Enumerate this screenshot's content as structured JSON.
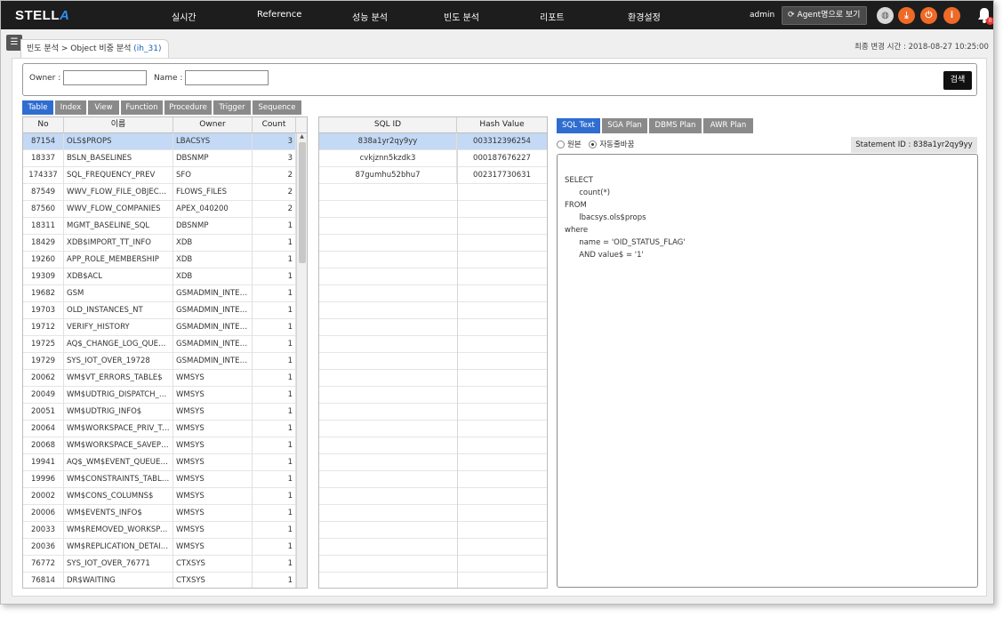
{
  "brand": {
    "name_prefix": "STELL",
    "name_suffix": "A"
  },
  "nav": [
    "실시간",
    "Reference",
    "성능 분석",
    "빈도 분석",
    "리포트",
    "환경설정"
  ],
  "header": {
    "user": "admin",
    "agent_button": "Agent명으로 보기",
    "notification_count": "0"
  },
  "breadcrumb": {
    "parent": "빈도 분석 > ",
    "current": "Object 비중 분석",
    "context": "(ih_31)"
  },
  "last_change": "최종 변경 시간 : 2018-08-27 10:25:00",
  "search": {
    "owner_label": "Owner :",
    "owner_value": "",
    "name_label": "Name :",
    "name_value": "",
    "button": "검색"
  },
  "object_tabs": [
    "Table",
    "Index",
    "View",
    "Function",
    "Procedure",
    "Trigger",
    "Sequence"
  ],
  "object_tab_selected": 0,
  "object_table": {
    "columns": [
      "No",
      "이름",
      "Owner",
      "Count"
    ],
    "rows": [
      [
        "87154",
        "OLS$PROPS",
        "LBACSYS",
        "3"
      ],
      [
        "18337",
        "BSLN_BASELINES",
        "DBSNMP",
        "3"
      ],
      [
        "174337",
        "SQL_FREQUENCY_PREV",
        "SFO",
        "2"
      ],
      [
        "87549",
        "WWV_FLOW_FILE_OBJECTS$",
        "FLOWS_FILES",
        "2"
      ],
      [
        "87560",
        "WWV_FLOW_COMPANIES",
        "APEX_040200",
        "2"
      ],
      [
        "18311",
        "MGMT_BASELINE_SQL",
        "DBSNMP",
        "1"
      ],
      [
        "18429",
        "XDB$IMPORT_TT_INFO",
        "XDB",
        "1"
      ],
      [
        "19260",
        "APP_ROLE_MEMBERSHIP",
        "XDB",
        "1"
      ],
      [
        "19309",
        "XDB$ACL",
        "XDB",
        "1"
      ],
      [
        "19682",
        "GSM",
        "GSMADMIN_INTERNAL",
        "1"
      ],
      [
        "19703",
        "OLD_INSTANCES_NT",
        "GSMADMIN_INTERNAL",
        "1"
      ],
      [
        "19712",
        "VERIFY_HISTORY",
        "GSMADMIN_INTERNAL",
        "1"
      ],
      [
        "19725",
        "AQ$_CHANGE_LOG_QUEUE_TABLE",
        "GSMADMIN_INTERNAL",
        "1"
      ],
      [
        "19729",
        "SYS_IOT_OVER_19728",
        "GSMADMIN_INTERNAL",
        "1"
      ],
      [
        "20062",
        "WM$VT_ERRORS_TABLE$",
        "WMSYS",
        "1"
      ],
      [
        "20049",
        "WM$UDTRIG_DISPATCH_PROCS$",
        "WMSYS",
        "1"
      ],
      [
        "20051",
        "WM$UDTRIG_INFO$",
        "WMSYS",
        "1"
      ],
      [
        "20064",
        "WM$WORKSPACE_PRIV_TABLE$",
        "WMSYS",
        "1"
      ],
      [
        "20068",
        "WM$WORKSPACE_SAVEPOINTS_TABLE$",
        "WMSYS",
        "1"
      ],
      [
        "19941",
        "AQ$_WM$EVENT_QUEUE_TABLE_S",
        "WMSYS",
        "1"
      ],
      [
        "19996",
        "WM$CONSTRAINTS_TABLE$",
        "WMSYS",
        "1"
      ],
      [
        "20002",
        "WM$CONS_COLUMNS$",
        "WMSYS",
        "1"
      ],
      [
        "20006",
        "WM$EVENTS_INFO$",
        "WMSYS",
        "1"
      ],
      [
        "20033",
        "WM$REMOVED_WORKSPACES_TABLE$",
        "WMSYS",
        "1"
      ],
      [
        "20036",
        "WM$REPLICATION_DETAILS_TABLE$",
        "WMSYS",
        "1"
      ],
      [
        "76772",
        "SYS_IOT_OVER_76771",
        "CTXSYS",
        "1"
      ],
      [
        "76814",
        "DR$WAITING",
        "CTXSYS",
        "1"
      ]
    ]
  },
  "sql_table": {
    "columns": [
      "SQL ID",
      "Hash Value"
    ],
    "rows": [
      [
        "838a1yr2qy9yy",
        "003312396254"
      ],
      [
        "cvkjznn5kzdk3",
        "000187676227"
      ],
      [
        "87gumhu52bhu7",
        "002317730631"
      ]
    ]
  },
  "plan_tabs": [
    "SQL Text",
    "SGA Plan",
    "DBMS Plan",
    "AWR Plan"
  ],
  "plan_tab_selected": 0,
  "text_mode": {
    "raw_label": "원본",
    "pretty_label": "자동줄바꿈"
  },
  "statement_id": "Statement ID : 838a1yr2qy9yy",
  "sql_text": [
    "SELECT",
    "      count(*)",
    "FROM",
    "      lbacsys.ols$props",
    "where",
    "      name = 'OID_STATUS_FLAG'",
    "      AND value$ = '1'"
  ],
  "colors": {
    "accent": "#2f6dd0",
    "selected_row": "#c3d9f5",
    "nav_bg": "#1d1d1d",
    "action": "#ee6a26"
  }
}
